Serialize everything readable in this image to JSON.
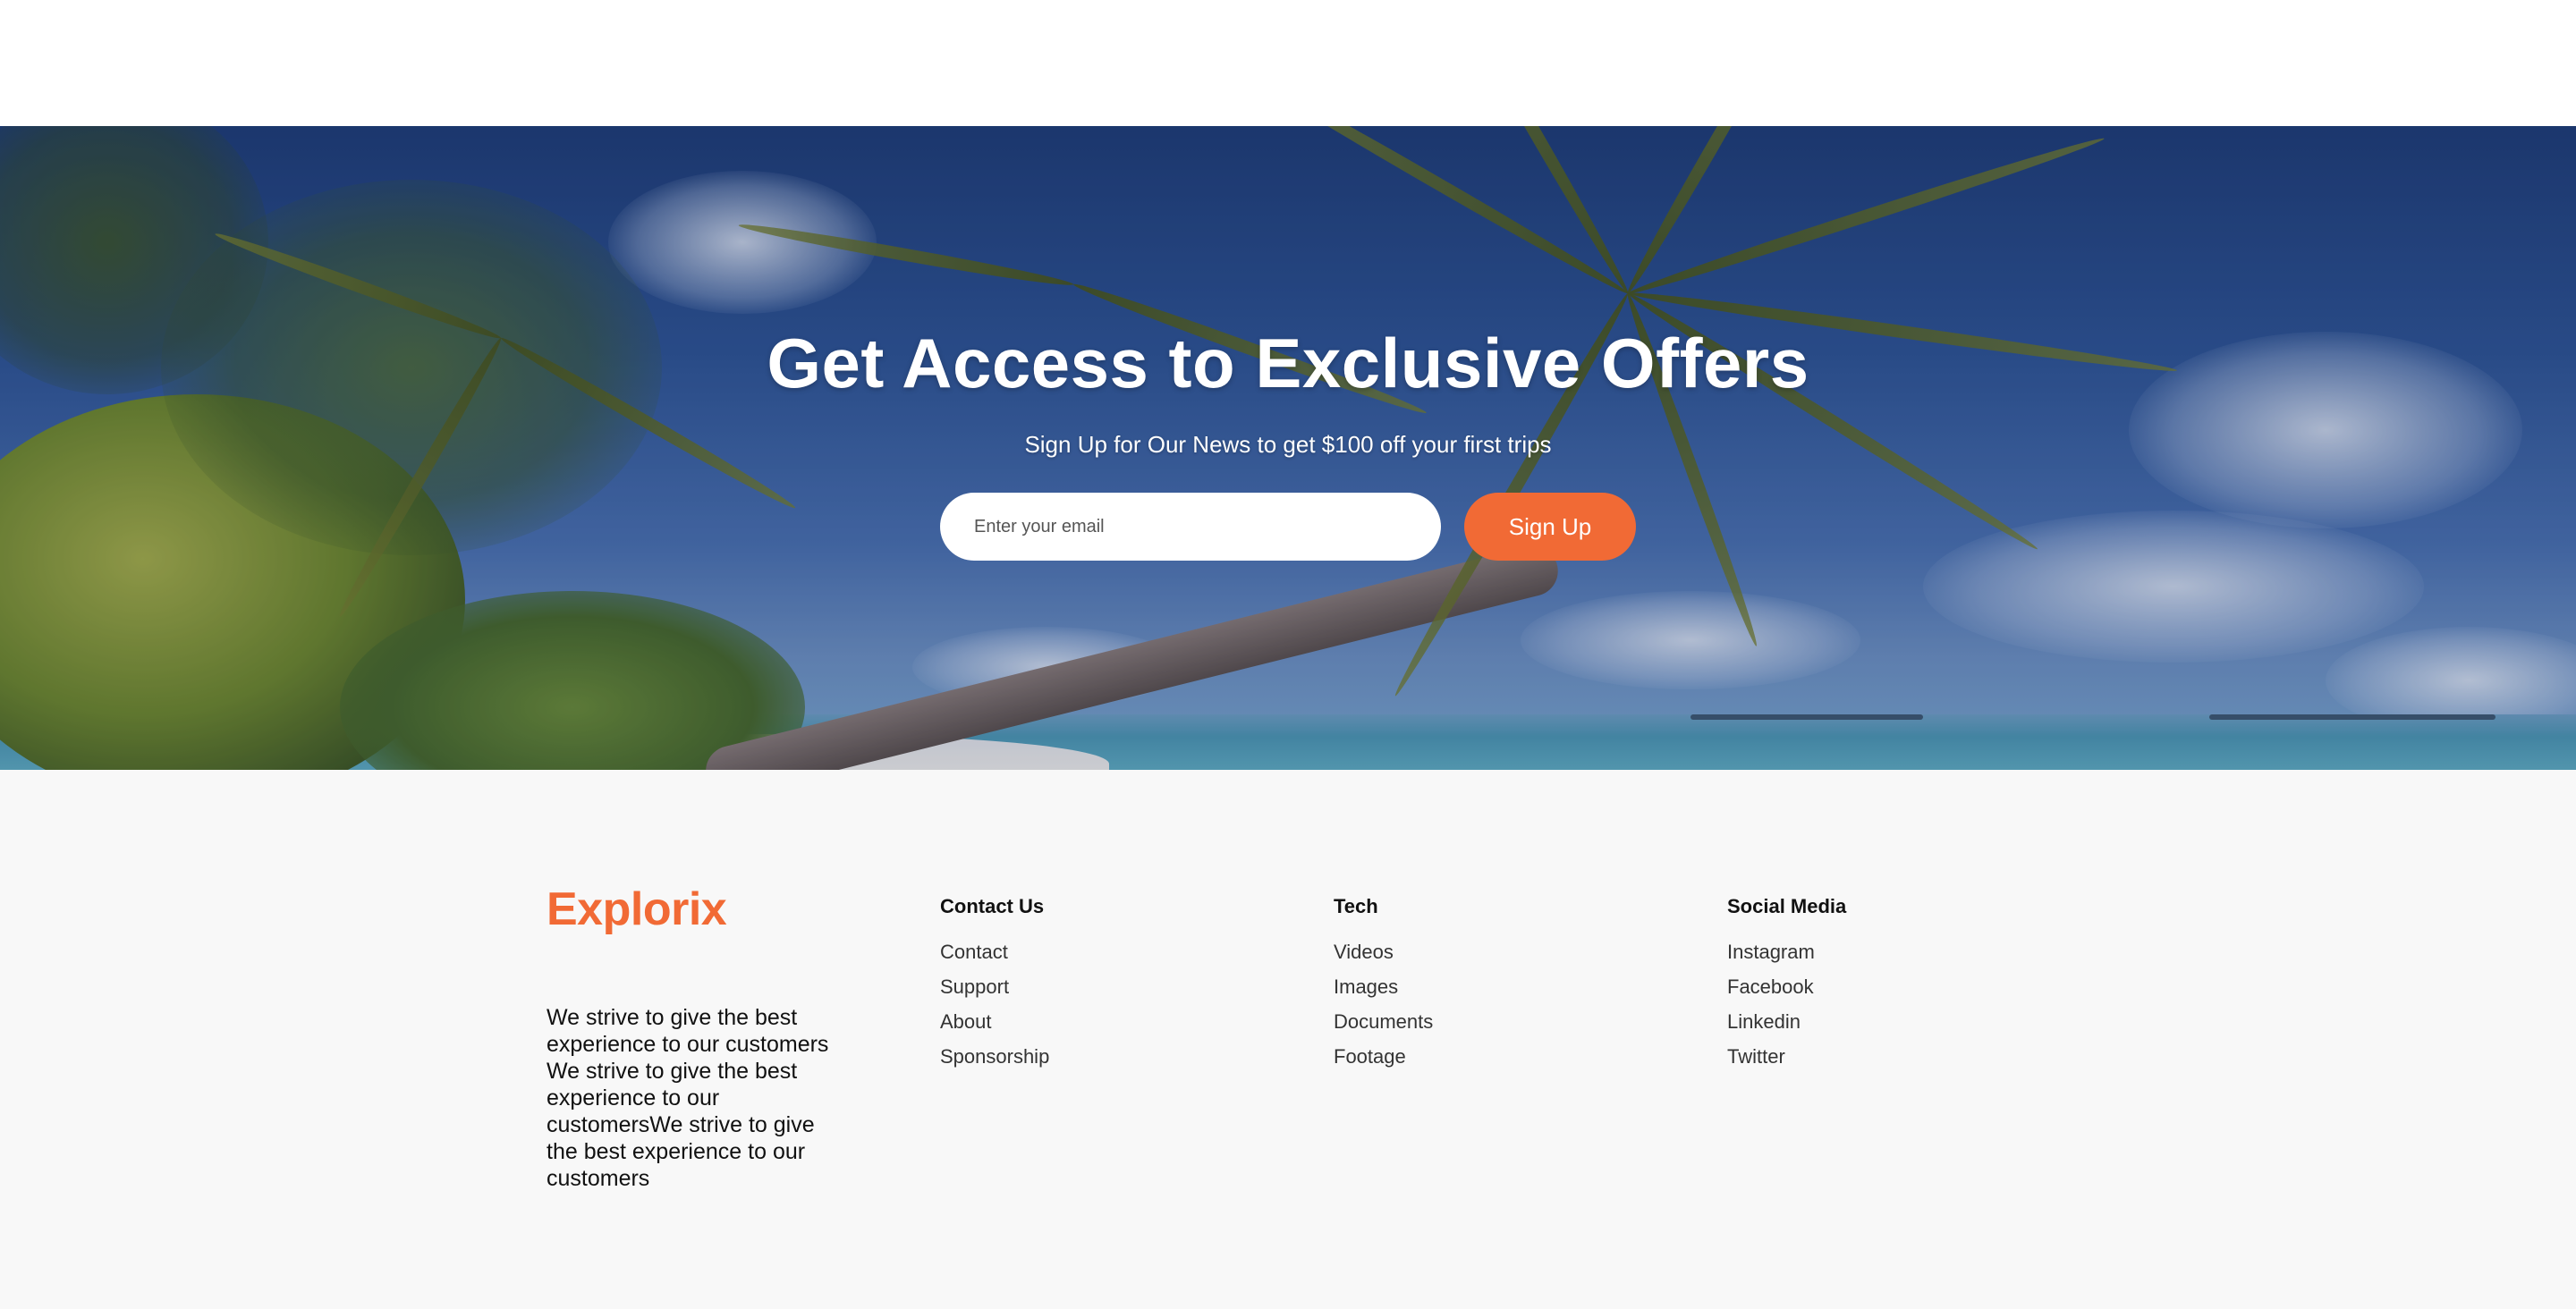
{
  "hero": {
    "title": "Get Access to Exclusive Offers",
    "subtitle": "Sign Up for Our News to get $100 off your first trips",
    "email_placeholder": "Enter your email",
    "signup_label": "Sign Up",
    "accent_color": "#f16a35"
  },
  "footer": {
    "brand": "Explorix",
    "description": "We strive to give the best experience to our customers We strive to give the best experience to our customersWe strive to give the best experience to our customers",
    "columns": [
      {
        "title": "Contact Us",
        "links": [
          "Contact",
          "Support",
          "About",
          "Sponsorship"
        ]
      },
      {
        "title": "Tech",
        "links": [
          "Videos",
          "Images",
          "Documents",
          "Footage"
        ]
      },
      {
        "title": "Social Media",
        "links": [
          "Instagram",
          "Facebook",
          "Linkedin",
          "Twitter"
        ]
      }
    ]
  }
}
